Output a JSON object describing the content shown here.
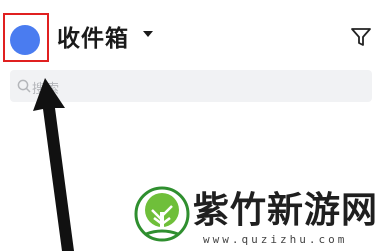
{
  "header": {
    "title": "收件箱",
    "avatar_icon": "avatar",
    "dropdown_icon": "caret-down-icon",
    "filter_icon": "filter-icon",
    "highlight_color": "#e02020",
    "avatar_color": "#4a7cf0"
  },
  "search": {
    "placeholder": "搜索",
    "icon": "search-icon"
  },
  "watermark": {
    "text": "紫竹新游网",
    "url": "www.quzizhu.com",
    "logo": "tree-logo"
  },
  "annotation": {
    "icon": "arrow-pointer",
    "color": "#111111"
  }
}
